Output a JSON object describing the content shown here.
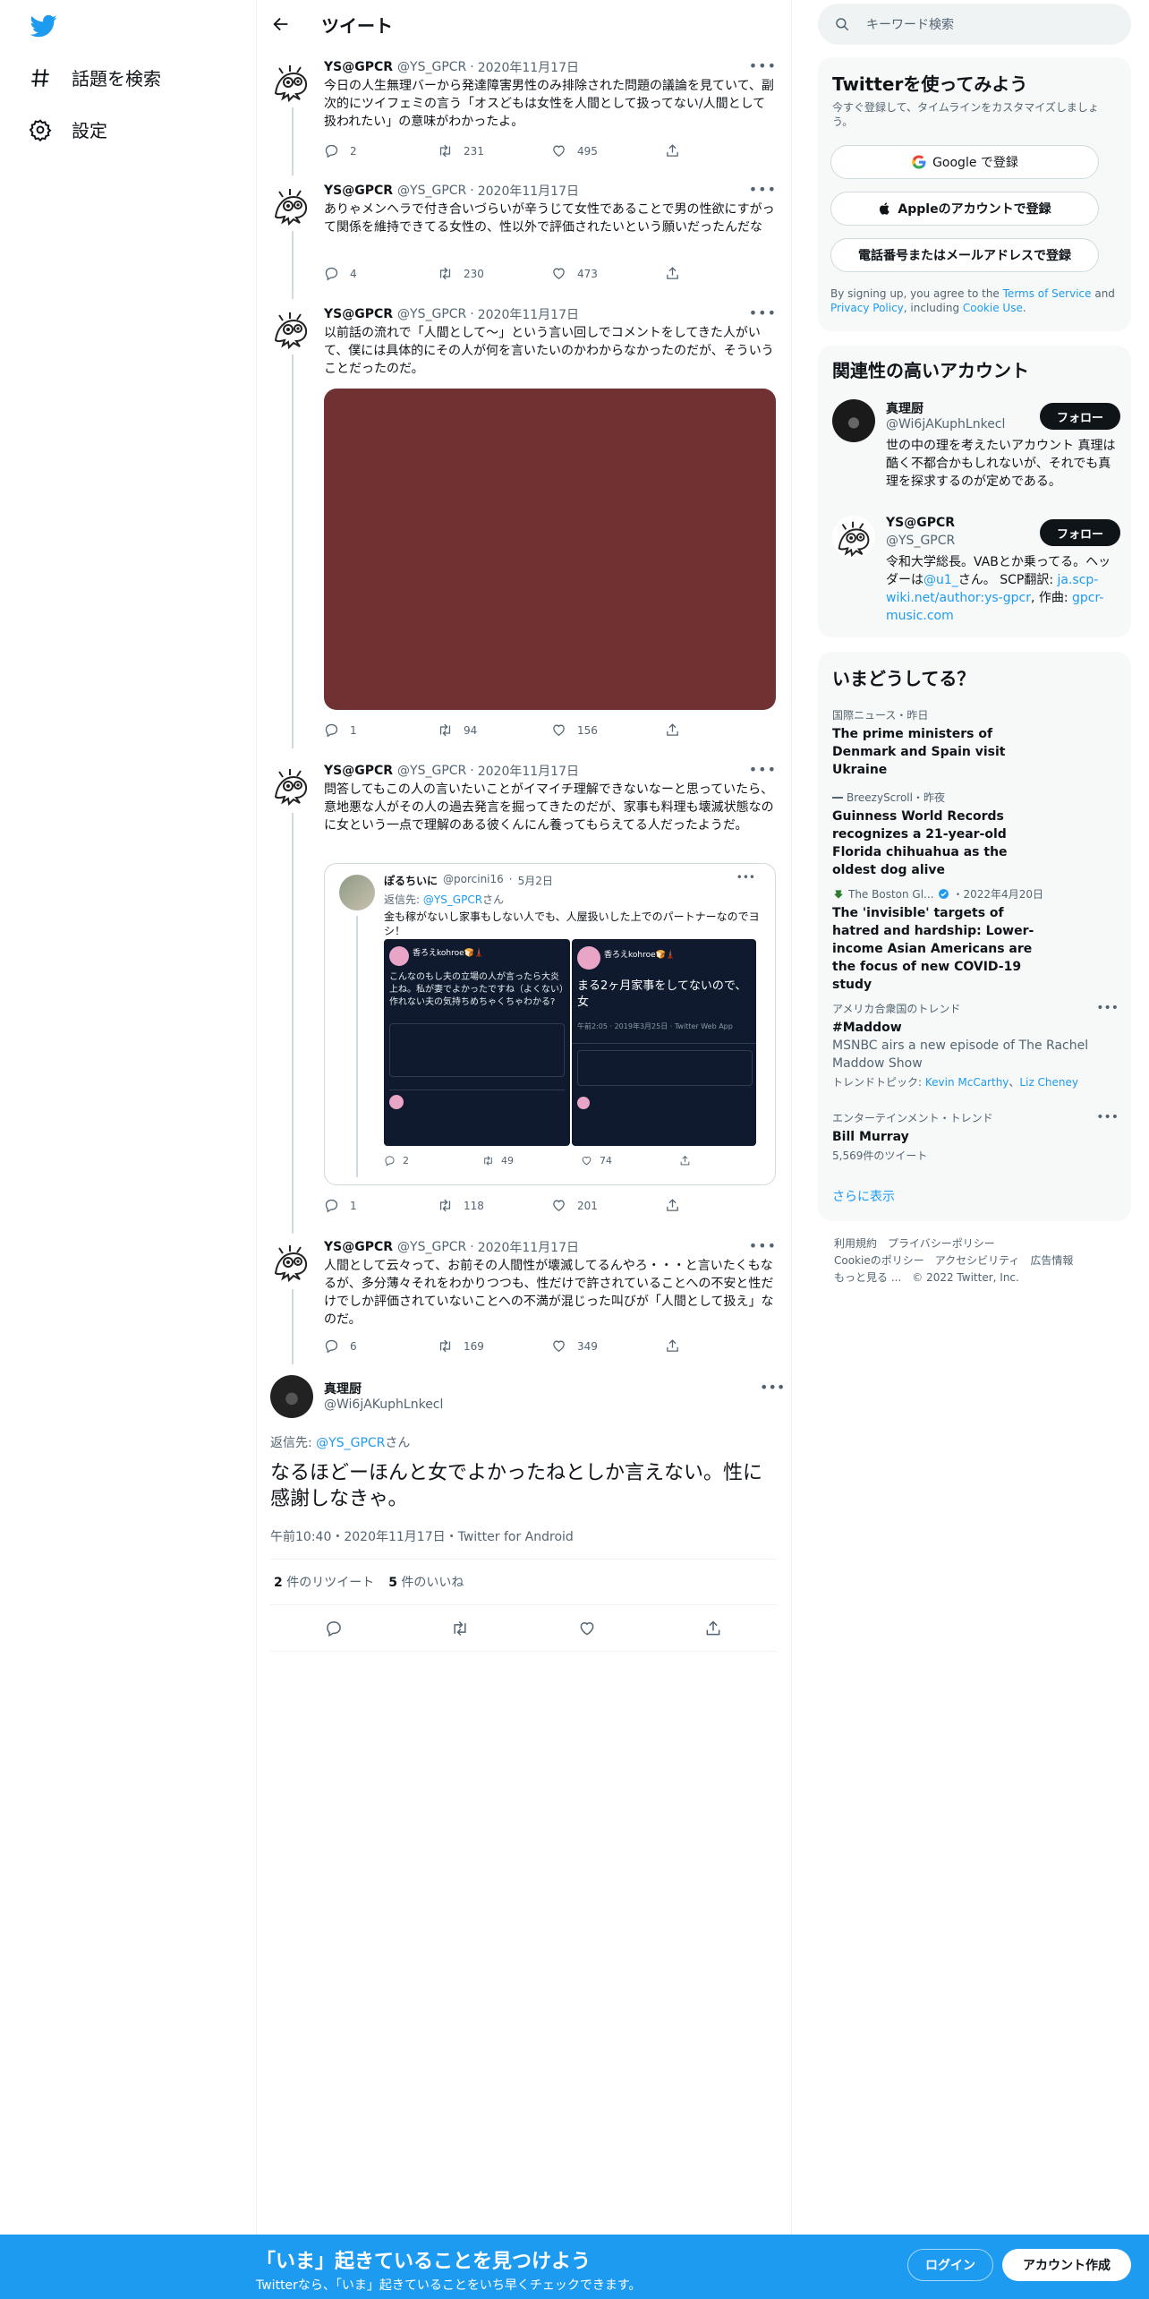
{
  "nav": {
    "explore_label": "話題を検索",
    "settings_label": "設定"
  },
  "header": {
    "title": "ツイート"
  },
  "thread": [
    {
      "name": "YS@GPCR",
      "handle": "@YS_GPCR",
      "date": "2020年11月17日",
      "text": "今日の人生無理バーから発達障害男性のみ排除された問題の議論を見ていて、副次的にツイフェミの言う「オスどもは女性を人間として扱ってない/人間として扱われたい」の意味がわかったよ。",
      "replies": "2",
      "retweets": "231",
      "likes": "495"
    },
    {
      "name": "YS@GPCR",
      "handle": "@YS_GPCR",
      "date": "2020年11月17日",
      "text": "ありゃメンヘラで付き合いづらいが辛うじて女性であることで男の性欲にすがって関係を維持できてる女性の、性以外で評価されたいという願いだったんだな",
      "replies": "4",
      "retweets": "230",
      "likes": "473"
    },
    {
      "name": "YS@GPCR",
      "handle": "@YS_GPCR",
      "date": "2020年11月17日",
      "text": "以前話の流れで「人間として～」という言い回しでコメントをしてきた人がいて、僕には具体的にその人が何を言いたいのかわからなかったのだが、そういうことだったのだ。",
      "replies": "1",
      "retweets": "94",
      "likes": "156"
    },
    {
      "name": "YS@GPCR",
      "handle": "@YS_GPCR",
      "date": "2020年11月17日",
      "text": "問答してもこの人の言いたいことがイマイチ理解できないなーと思っていたら、意地悪な人がその人の過去発言を掘ってきたのだが、家事も料理も壊滅状態なのに女という一点で理解のある彼くんにん養ってもらえてる人だったようだ。",
      "replies": "1",
      "retweets": "118",
      "likes": "201"
    },
    {
      "name": "YS@GPCR",
      "handle": "@YS_GPCR",
      "date": "2020年11月17日",
      "text": "人間として云々って、お前その人間性が壊滅してるんやろ・・・と言いたくもなるが、多分薄々それをわかりつつも、性だけで許されていることへの不安と性だけでしか評価されていないことへの不満が混じった叫びが「人間として扱え」なのだ。",
      "replies": "6",
      "retweets": "169",
      "likes": "349"
    }
  ],
  "quote": {
    "name": "ぽるちいに",
    "handle": "@porcini16",
    "date": "5月2日",
    "reply_prefix": "返信先: ",
    "reply_to": "@YS_GPCR",
    "reply_suffix": "さん",
    "text": "金も稼がないし家事もしない人でも、人屋扱いした上でのパートナーなのでヨシ！",
    "img_left_name": "香ろえkohroe🍞🗼",
    "img_left_text": "こんなのもし夫の立場の人が言ったら大炎上ね。私が妻でよかったですね（よくない）作れない夫の気持ちめちゃくちゃわかる?",
    "img_right_name": "香ろえkohroe🍞🗼",
    "img_right_text": "まる2ヶ月家事をしてないので、女",
    "img_right_meta": "午前2:05 · 2019年3月25日 · Twitter Web App",
    "replies": "2",
    "retweets": "49",
    "likes": "74"
  },
  "focus": {
    "name": "真理厨",
    "handle": "@Wi6jAKuphLnkecl",
    "reply_prefix": "返信先: ",
    "reply_to": "@YS_GPCR",
    "reply_suffix": "さん",
    "text": "なるほどーほんと女でよかったねとしか言えない。性に感謝しなきゃ。",
    "meta": "午前10:40・2020年11月17日・Twitter for Android",
    "retweet_count": "2",
    "retweet_label": " 件のリツイート",
    "like_count": "5",
    "like_label": " 件のいいね"
  },
  "search": {
    "placeholder": "キーワード検索"
  },
  "signup_panel": {
    "title": "Twitterを使ってみよう",
    "subtitle": "今すぐ登録して、タイムラインをカスタマイズしましょう。",
    "google": "Google で登録",
    "apple": "Appleのアカウントで登録",
    "phone": "電話番号またはメールアドレスで登録",
    "legal_1": "By signing up, you agree to the ",
    "legal_terms": "Terms of Service",
    "legal_2": " and ",
    "legal_privacy": "Privacy Policy",
    "legal_3": ", including ",
    "legal_cookie": "Cookie Use",
    "legal_4": "."
  },
  "related": {
    "title": "関連性の高いアカウント",
    "follow_label": "フォロー",
    "accounts": [
      {
        "name": "真理厨",
        "handle": "@Wi6jAKuphLnkecl",
        "bio": "世の中の理を考えたいアカウント 真理は酷く不都合かもしれないが、それでも真理を探求するのが定めである。"
      },
      {
        "name": "YS@GPCR",
        "handle": "@YS_GPCR",
        "bio_1": "令和大学総長。VABとか乗ってる。ヘッダーは",
        "bio_link1": "@u1_",
        "bio_2": "さん。 SCP翻訳: ",
        "bio_link2": "ja.scp-wiki.net/author:ys-gpcr",
        "bio_3": ", 作曲: ",
        "bio_link3": "gpcr-music.com"
      }
    ]
  },
  "trends": {
    "title": "いまどうしてる？",
    "items": [
      {
        "meta": "国際ニュース・昨日",
        "title": "The prime ministers of Denmark and Spain visit Ukraine"
      },
      {
        "meta": "BreezyScroll・昨夜",
        "title": "Guinness World Records recognizes a 21-year-old Florida chihuahua as the oldest dog alive"
      },
      {
        "meta_source": "The Boston Gl...",
        "meta_date": "・2022年4月20日",
        "title": "The 'invisible' targets of hatred and hardship: Lower-income Asian Americans are the focus of new COVID-19 study"
      },
      {
        "meta": "アメリカ合衆国のトレンド",
        "title": "#Maddow",
        "sub": "MSNBC airs a new episode of The Rachel Maddow Show",
        "links_prefix": "トレンドトピック: ",
        "link1": "Kevin McCarthy",
        "link_sep": "、",
        "link2": "Liz Cheney"
      },
      {
        "meta": "エンターテインメント・トレンド",
        "title": "Bill Murray",
        "sub": "5,569件のツイート"
      }
    ],
    "show_more": "さらに表示"
  },
  "footer": {
    "terms": "利用規約",
    "privacy": "プライバシーポリシー",
    "cookie": "Cookieのポリシー",
    "accessibility": "アクセシビリティ",
    "ads": "広告情報",
    "more": "もっと見る ...",
    "copyright": "© 2022 Twitter, Inc."
  },
  "bottom_bar": {
    "title": "「いま」起きていることを見つけよう",
    "subtitle": "Twitterなら、「いま」起きていることをいち早くチェックできます。",
    "login": "ログイン",
    "signup": "アカウント作成"
  },
  "colors": {
    "accent": "#1d9bf0",
    "media": "#703133",
    "text": "#0f1419",
    "muted": "#536471"
  }
}
